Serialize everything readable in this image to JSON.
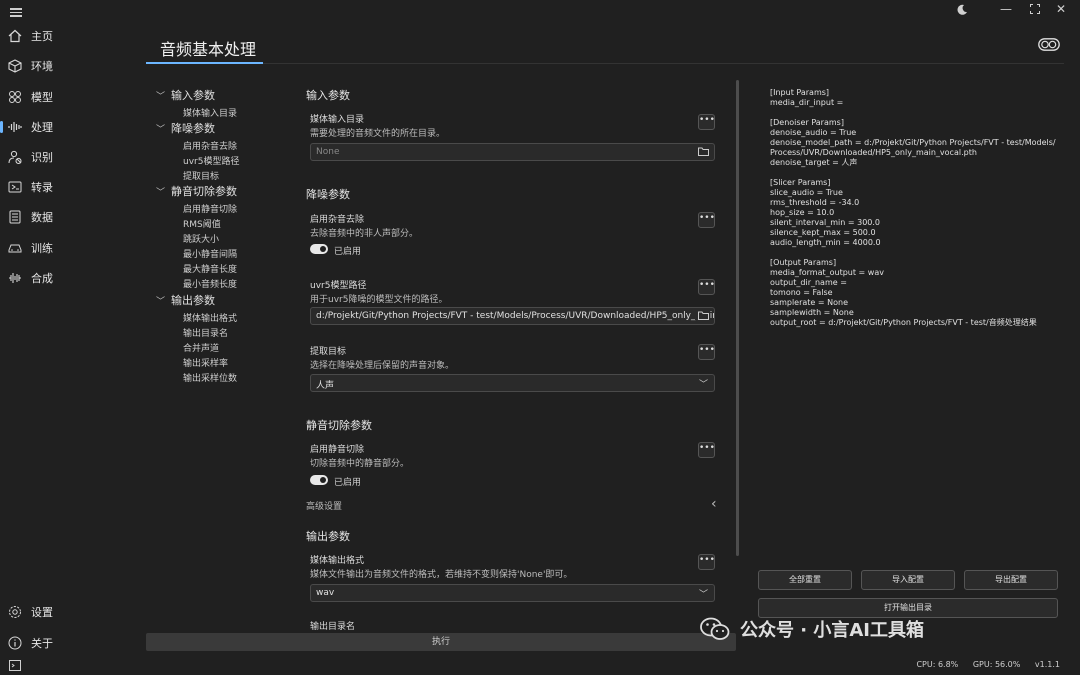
{
  "nav": {
    "items": [
      {
        "label": "主页",
        "icon": "home-icon"
      },
      {
        "label": "环境",
        "icon": "cube-icon"
      },
      {
        "label": "模型",
        "icon": "models-icon"
      },
      {
        "label": "处理",
        "icon": "waveform-icon"
      },
      {
        "label": "识别",
        "icon": "recognize-icon"
      },
      {
        "label": "转录",
        "icon": "transcribe-icon"
      },
      {
        "label": "数据",
        "icon": "database-icon"
      },
      {
        "label": "训练",
        "icon": "train-icon"
      },
      {
        "label": "合成",
        "icon": "synthesize-icon"
      }
    ],
    "active_index": 3,
    "bottom": [
      {
        "label": "设置",
        "icon": "gear-icon"
      },
      {
        "label": "关于",
        "icon": "info-icon"
      }
    ]
  },
  "header": {
    "title": "音频基本处理"
  },
  "tree": {
    "groups": [
      {
        "label": "输入参数",
        "items": [
          "媒体输入目录"
        ]
      },
      {
        "label": "降噪参数",
        "items": [
          "启用杂音去除",
          "uvr5模型路径",
          "提取目标"
        ]
      },
      {
        "label": "静音切除参数",
        "items": [
          "启用静音切除",
          "RMS阈值",
          "跳跃大小",
          "最小静音间隔",
          "最大静音长度",
          "最小音频长度"
        ]
      },
      {
        "label": "输出参数",
        "items": [
          "媒体输出格式",
          "输出目录名",
          "合并声道",
          "输出采样率",
          "输出采样位数"
        ]
      }
    ]
  },
  "settings": {
    "input": {
      "title": "输入参数",
      "media_dir": {
        "title": "媒体输入目录",
        "desc": "需要处理的音频文件的所在目录。",
        "placeholder": "None"
      }
    },
    "denoise": {
      "title": "降噪参数",
      "enable": {
        "title": "启用杂音去除",
        "desc": "去除音频中的非人声部分。",
        "state": "已启用"
      },
      "model_path": {
        "title": "uvr5模型路径",
        "desc": "用于uvr5降噪的模型文件的路径。",
        "value": "d:/Projekt/Git/Python Projects/FVT - test/Models/Process/UVR/Downloaded/HP5_only_main_vocal.pth"
      },
      "target": {
        "title": "提取目标",
        "desc": "选择在降噪处理后保留的声音对象。",
        "value": "人声"
      }
    },
    "slicer": {
      "title": "静音切除参数",
      "enable": {
        "title": "启用静音切除",
        "desc": "切除音频中的静音部分。",
        "state": "已启用"
      },
      "advanced": "高级设置"
    },
    "output": {
      "title": "输出参数",
      "format": {
        "title": "媒体输出格式",
        "desc": "媒体文件输出为音频文件的格式，若维持不变则保持'None'即可。",
        "value": "wav"
      },
      "dir_name": {
        "title": "输出目录名"
      }
    },
    "run_label": "执行"
  },
  "output_panel": {
    "text": "[Input Params]\nmedia_dir_input = \n\n[Denoiser Params]\ndenoise_audio = True\ndenoise_model_path = d:/Projekt/Git/Python Projects/FVT - test/Models/\nProcess/UVR/Downloaded/HP5_only_main_vocal.pth\ndenoise_target = 人声\n\n[Slicer Params]\nslice_audio = True\nrms_threshold = -34.0\nhop_size = 10.0\nsilent_interval_min = 300.0\nsilence_kept_max = 500.0\naudio_length_min = 4000.0\n\n[Output Params]\nmedia_format_output = wav\noutput_dir_name = \ntomono = False\nsamplerate = None\nsamplewidth = None\noutput_root = d:/Projekt/Git/Python Projects/FVT - test/音频处理结果",
    "buttons": {
      "reset_all": "全部重置",
      "import": "导入配置",
      "export": "导出配置",
      "open_output": "打开输出目录"
    }
  },
  "status": {
    "cpu": "CPU: 6.8%",
    "gpu": "GPU: 56.0%",
    "version": "v1.1.1"
  },
  "watermark": "公众号 · 小言AI工具箱",
  "colors": {
    "accent": "#6cb6ff",
    "background": "#202020"
  }
}
